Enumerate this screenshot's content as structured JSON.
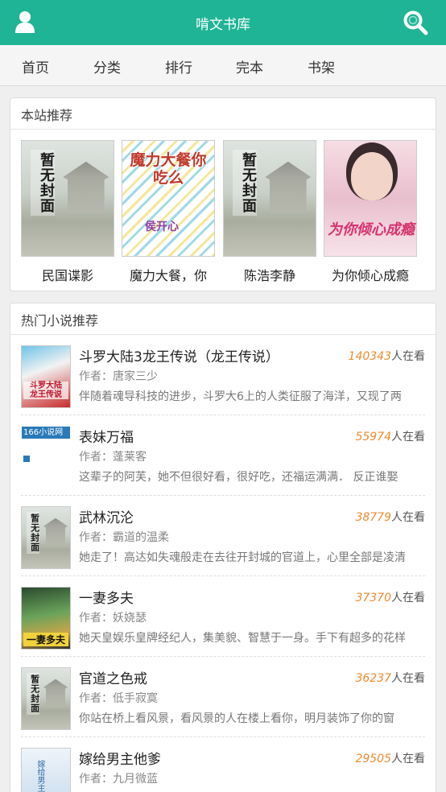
{
  "header": {
    "title": "啃文书库",
    "left_icon": "user-icon",
    "right_icon": "search-icon",
    "bg_color": "#1fb496"
  },
  "nav": {
    "tabs": [
      "首页",
      "分类",
      "排行",
      "完本",
      "书架"
    ]
  },
  "recommend": {
    "heading": "本站推荐",
    "books": [
      {
        "title": "民国谍影",
        "cover": "no-cover",
        "cover_text": "暂无封面"
      },
      {
        "title": "魔力大餐，你",
        "cover": "art",
        "cover_text": "魔力大餐你吃么",
        "cover_author": "侯开心"
      },
      {
        "title": "陈浩李静",
        "cover": "no-cover",
        "cover_text": "暂无封面"
      },
      {
        "title": "为你倾心成瘾",
        "cover": "art",
        "cover_text": "为你倾心成瘾"
      }
    ]
  },
  "hot": {
    "heading": "热门小说推荐",
    "reading_suffix": "人在看",
    "author_prefix": "作者：",
    "items": [
      {
        "title": "斗罗大陆3龙王传说（龙王传说）",
        "readers": "140343",
        "author": "唐家三少",
        "desc": "伴随着魂导科技的进步，斗罗大6上的人类征服了海洋，又现了两",
        "cover": "art"
      },
      {
        "title": "表妹万福",
        "readers": "55974",
        "author": "蓬莱客",
        "desc": "这辈子的阿芙，她不但很好看，很好吃，还福运满满．  反正谁娶",
        "cover": "site-166",
        "cover_text": "166小说网"
      },
      {
        "title": "武林沉沦",
        "readers": "38779",
        "author": "霸道的温柔",
        "desc": "她走了！高达如失魂般走在去往开封城的官道上，心里全部是凌清",
        "cover": "no-cover",
        "cover_text": "暂无封面"
      },
      {
        "title": "一妻多夫",
        "readers": "37370",
        "author": "妖娆瑟",
        "desc": "她天皇娱乐皇牌经纪人，集美貌、智慧于一身。手下有超多的花样",
        "cover": "art",
        "cover_text": "一妻多夫"
      },
      {
        "title": "官道之色戒",
        "readers": "36237",
        "author": "低手寂寞",
        "desc": "你站在桥上看风景，看风景的人在楼上看你，明月装饰了你的窗",
        "cover": "no-cover",
        "cover_text": "暂无封面"
      },
      {
        "title": "嫁给男主他爹",
        "readers": "29505",
        "author": "九月微蓝",
        "desc": "",
        "cover": "art",
        "cover_text": "嫁给男主他爹"
      }
    ]
  }
}
